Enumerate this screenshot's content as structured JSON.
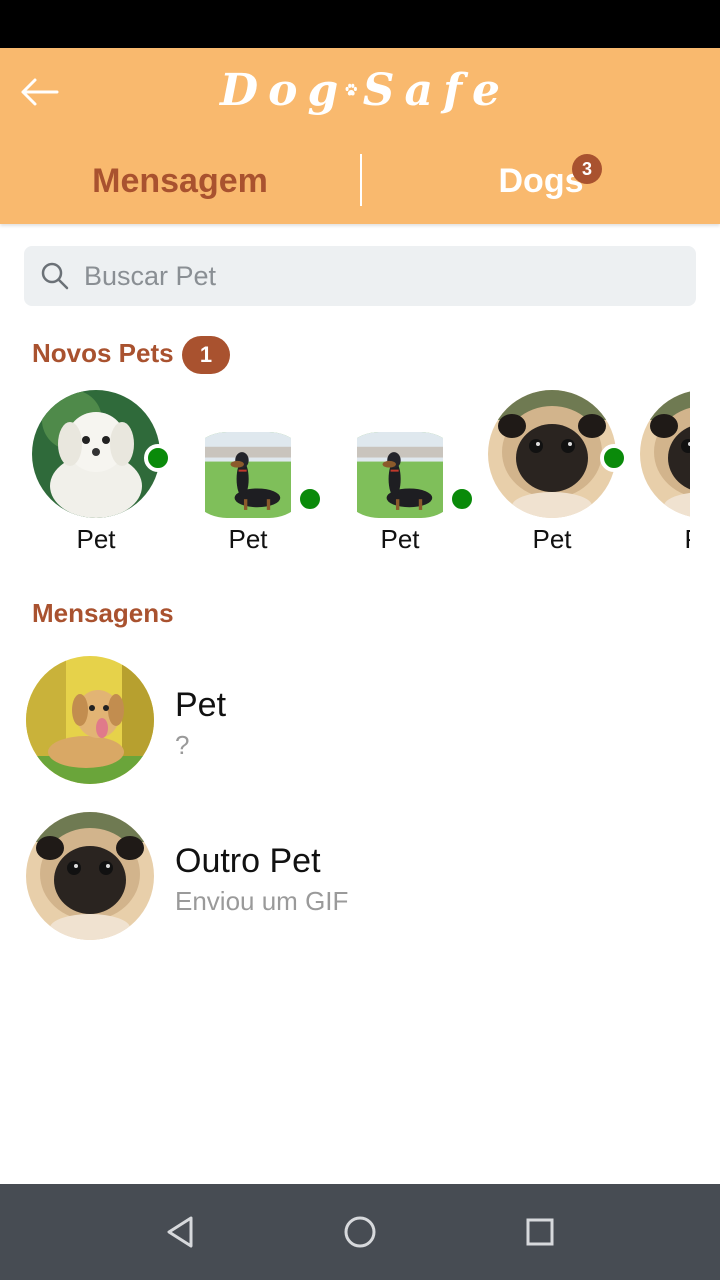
{
  "header": {
    "logo_left": "Dog",
    "logo_right": "Safe",
    "back_icon": "arrow-left-icon"
  },
  "tabs": [
    {
      "label": "Mensagem",
      "active": true
    },
    {
      "label": "Dogs",
      "badge": "3"
    }
  ],
  "search": {
    "placeholder": "Buscar Pet",
    "value": ""
  },
  "new_pets": {
    "title": "Novos Pets",
    "badge": "1",
    "items": [
      {
        "name": "Pet",
        "online": true,
        "photo": "white-maltese-puppy"
      },
      {
        "name": "Pet",
        "online": true,
        "photo": "dachshund-on-grass"
      },
      {
        "name": "Pet",
        "online": true,
        "photo": "dachshund-on-grass"
      },
      {
        "name": "Pet",
        "online": true,
        "photo": "pug"
      },
      {
        "name": "Pet",
        "online": false,
        "photo": "pug"
      }
    ]
  },
  "messages": {
    "title": "Mensagens",
    "items": [
      {
        "name": "Pet",
        "preview": "?",
        "photo": "golden-labrador"
      },
      {
        "name": "Outro Pet",
        "preview": "Enviou um GIF",
        "photo": "pug"
      }
    ]
  },
  "nav": [
    "back-triangle-icon",
    "home-circle-icon",
    "recents-square-icon"
  ],
  "colors": {
    "header": "#f9b96e",
    "accent": "#a9522f",
    "online": "#0a8a0a"
  }
}
